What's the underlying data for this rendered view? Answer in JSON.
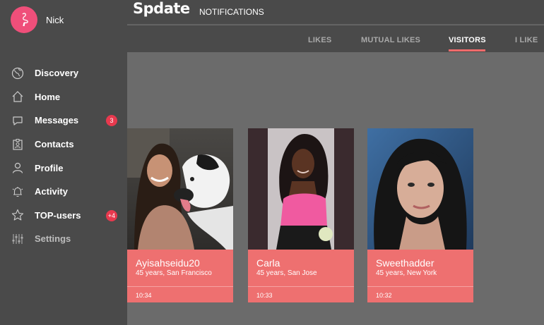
{
  "user": {
    "name": "Nick"
  },
  "header": {
    "logo": "Spdate",
    "title": "NOTIFICATIONS"
  },
  "sidebar": {
    "items": [
      {
        "label": "Discovery",
        "icon": "globe-icon"
      },
      {
        "label": "Home",
        "icon": "home-icon"
      },
      {
        "label": "Messages",
        "icon": "chat-icon",
        "badge": "3"
      },
      {
        "label": "Contacts",
        "icon": "contacts-icon"
      },
      {
        "label": "Profile",
        "icon": "user-icon"
      },
      {
        "label": "Activity",
        "icon": "bell-icon"
      },
      {
        "label": "TOP-users",
        "icon": "star-icon",
        "badge": "+4"
      },
      {
        "label": "Settings",
        "icon": "sliders-icon"
      }
    ]
  },
  "tabs": [
    {
      "label": "LIKES",
      "active": false
    },
    {
      "label": "MUTUAL LIKES",
      "active": false
    },
    {
      "label": "VISITORS",
      "active": true
    },
    {
      "label": "I LIKE",
      "active": false
    }
  ],
  "visitors": [
    {
      "name": "Ayisahseidu20",
      "details": "45 years, San Francisco",
      "time": "10:34"
    },
    {
      "name": "Carla",
      "details": "45 years, San Jose",
      "time": "10:33"
    },
    {
      "name": "Sweethadder",
      "details": "45 years, New York",
      "time": "10:32"
    }
  ],
  "colors": {
    "accent": "#ee7070",
    "badge": "#e8394e",
    "avatar": "#ef4f7a",
    "sidebar": "#4a4a4a",
    "content": "#6b6b6b"
  }
}
